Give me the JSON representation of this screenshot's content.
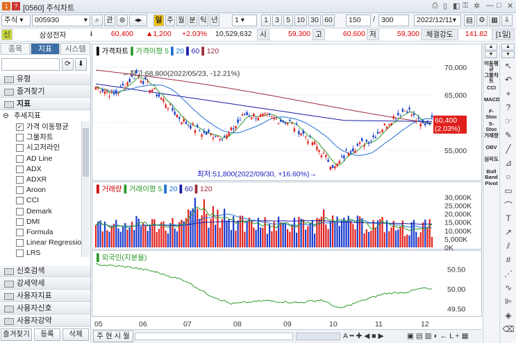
{
  "window": {
    "number": "1",
    "code": "[0560]",
    "title": "주식차트",
    "date": "2022/12/11"
  },
  "toolbar": {
    "market": "주식",
    "code": "005930",
    "search_btn": "관",
    "period_active": "일",
    "periods": [
      "주",
      "월",
      "분",
      "틱",
      "년"
    ],
    "interval_value": "1",
    "quick": [
      "1",
      "3",
      "5",
      "10",
      "30",
      "60"
    ],
    "count": "150",
    "total": "300"
  },
  "quote": {
    "name": "삼성전자",
    "price": "60,400",
    "change": "▲1,200",
    "change_pct": "+2.03%",
    "volume": "10,529,632",
    "open_label": "시",
    "open": "59,300",
    "high_label": "고",
    "high": "60,600",
    "low_label": "저",
    "low": "59,300",
    "strength_label": "체결강도",
    "strength": "141.82",
    "unit": "[1일]"
  },
  "left_panel": {
    "tabs": [
      "종목",
      "지표",
      "시스템"
    ],
    "folders_top": [
      "유형",
      "즐겨찾기",
      "지표"
    ],
    "group": "추세지표",
    "items": [
      {
        "label": "가격 이동평균",
        "checked": true
      },
      {
        "label": "그물차트",
        "checked": false
      },
      {
        "label": "시고저라인",
        "checked": false
      },
      {
        "label": "AD Line",
        "checked": false
      },
      {
        "label": "ADX",
        "checked": false
      },
      {
        "label": "ADXR",
        "checked": false
      },
      {
        "label": "Aroon",
        "checked": false
      },
      {
        "label": "CCI",
        "checked": false
      },
      {
        "label": "Demark",
        "checked": false
      },
      {
        "label": "DMI",
        "checked": false
      },
      {
        "label": "Formula",
        "checked": false
      },
      {
        "label": "Linear Regression",
        "checked": false
      },
      {
        "label": "LRS",
        "checked": false
      }
    ],
    "folders_bottom": [
      "신호검색",
      "강세약세",
      "사용자지표",
      "사용자신호",
      "사용자강약"
    ],
    "bottom_buttons": [
      "즐겨찾기",
      "등록",
      "삭제"
    ]
  },
  "price_pane": {
    "legend": [
      {
        "text": "가격차트",
        "color": "#000"
      },
      {
        "text": "가격이평 5",
        "color": "#2a9a2a"
      },
      {
        "text": "20",
        "color": "#1e6fd0"
      },
      {
        "text": "60",
        "color": "#1a1aa8"
      },
      {
        "text": "120",
        "color": "#9b2a3a"
      }
    ],
    "high_note": "←최고:68,800(2022/05/23, -12.21%)",
    "low_note": "최저:51,800(2022/09/30, +16.60%)→",
    "y_labels": [
      "70,000",
      "65,000",
      "60,000",
      "55,000"
    ],
    "last_price": "60,400",
    "last_pct": "(2.03%)"
  },
  "volume_pane": {
    "legend": [
      {
        "text": "거래량",
        "color": "#c00"
      },
      {
        "text": "거래이평 5",
        "color": "#2a9a2a"
      },
      {
        "text": "20",
        "color": "#1e6fd0"
      },
      {
        "text": "60",
        "color": "#1a1aa8"
      },
      {
        "text": "120",
        "color": "#9b2a3a"
      }
    ],
    "y_labels": [
      "30,000K",
      "25,000K",
      "20,000K",
      "15,000K",
      "10,000K",
      "5,000K",
      "0K"
    ]
  },
  "foreign_pane": {
    "legend": [
      {
        "text": "외국인(지분율)",
        "color": "#2a9a2a"
      }
    ],
    "y_labels": [
      "50.50",
      "50.00",
      "49.50"
    ]
  },
  "x_labels": [
    "05",
    "06",
    "07",
    "08",
    "09",
    "10",
    "11",
    "12"
  ],
  "right_tools": [
    "이동평균",
    "그물차트",
    "CCI",
    "MACD",
    "F-Stoc",
    "S-Stoc",
    "거래량",
    "OBV",
    "심리도",
    "Boll Band",
    "Pivot"
  ],
  "chart_data": {
    "type": "candlestick",
    "x_axis": [
      "05",
      "06",
      "07",
      "08",
      "09",
      "10",
      "11",
      "12"
    ],
    "price_range": [
      50000,
      72000
    ],
    "max": {
      "value": 68800,
      "date": "2022/05/23"
    },
    "min": {
      "value": 51800,
      "date": "2022/09/30"
    },
    "last": 60400
  }
}
